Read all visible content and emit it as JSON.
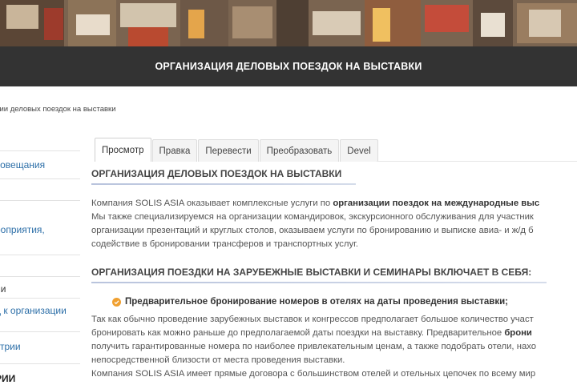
{
  "header": {
    "title": "ОРГАНИЗАЦИЯ ДЕЛОВЫХ ПОЕЗДОК НА ВЫСТАВКИ"
  },
  "breadcrumb": "ции деловых поездок на выставки",
  "sidebar": {
    "items": [
      "совещания",
      "роприятия,",
      "ии",
      "д к организации",
      "стрии",
      "РИИ"
    ]
  },
  "tabs": [
    "Просмотр",
    "Правка",
    "Перевести",
    "Преобразовать",
    "Devel"
  ],
  "content": {
    "heading1": "ОРГАНИЗАЦИЯ ДЕЛОВЫХ ПОЕЗДОК НА ВЫСТАВКИ",
    "intro": {
      "l1_normal": "Компания SOLIS ASIA оказывает комплексные услуги по ",
      "l1_bold": "организации поездок на международные выс",
      "l2": "Мы также специализируемся на организации командировок, экскурсионного обслуживания для участник",
      "l3": "организации презентаций и круглых столов, оказываем услуги по бронированию и выписке авиа- и ж/д б",
      "l4": "содействие в бронировании трансферов и транспортных услуг."
    },
    "heading2": "ОРГАНИЗАЦИЯ ПОЕЗДКИ НА ЗАРУБЕЖНЫЕ ВЫСТАВКИ И СЕМИНАРЫ ВКЛЮЧАЕТ В СЕБЯ:",
    "bullet1": "Предварительное бронирование номеров в отелях на даты проведения выставки;",
    "para2": {
      "l1": "Так как обычно проведение зарубежных выставок и конгрессов предполагает большое количество участ",
      "l2_normal": "бронировать как можно раньше до предполагаемой даты поездки на выставку. Предварительное ",
      "l2_bold": "брони",
      "l3": "получить гарантированные номера по наиболее привлекательным ценам, а также подобрать отели, нахо",
      "l4": "непосредственной близости от места проведения выставки.",
      "l5": "Компания SOLIS ASIA имеет прямые договора с большинством отелей и отельных цепочек по всему мир"
    }
  },
  "colors": {
    "title_band": "#333333",
    "link": "#2d6fa8",
    "bullet_icon": "#f0a030"
  }
}
